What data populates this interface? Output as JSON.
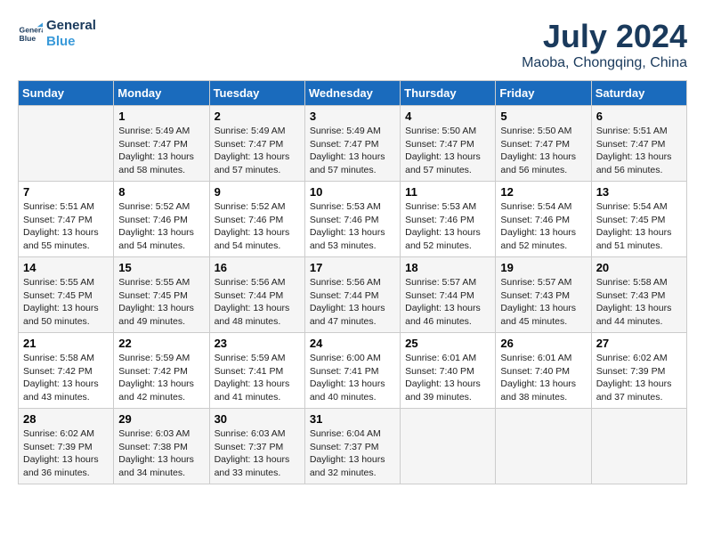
{
  "header": {
    "logo_line1": "General",
    "logo_line2": "Blue",
    "month": "July 2024",
    "location": "Maoba, Chongqing, China"
  },
  "days_of_week": [
    "Sunday",
    "Monday",
    "Tuesday",
    "Wednesday",
    "Thursday",
    "Friday",
    "Saturday"
  ],
  "weeks": [
    [
      {
        "day": "",
        "sunrise": "",
        "sunset": "",
        "daylight": ""
      },
      {
        "day": "1",
        "sunrise": "Sunrise: 5:49 AM",
        "sunset": "Sunset: 7:47 PM",
        "daylight": "Daylight: 13 hours and 58 minutes."
      },
      {
        "day": "2",
        "sunrise": "Sunrise: 5:49 AM",
        "sunset": "Sunset: 7:47 PM",
        "daylight": "Daylight: 13 hours and 57 minutes."
      },
      {
        "day": "3",
        "sunrise": "Sunrise: 5:49 AM",
        "sunset": "Sunset: 7:47 PM",
        "daylight": "Daylight: 13 hours and 57 minutes."
      },
      {
        "day": "4",
        "sunrise": "Sunrise: 5:50 AM",
        "sunset": "Sunset: 7:47 PM",
        "daylight": "Daylight: 13 hours and 57 minutes."
      },
      {
        "day": "5",
        "sunrise": "Sunrise: 5:50 AM",
        "sunset": "Sunset: 7:47 PM",
        "daylight": "Daylight: 13 hours and 56 minutes."
      },
      {
        "day": "6",
        "sunrise": "Sunrise: 5:51 AM",
        "sunset": "Sunset: 7:47 PM",
        "daylight": "Daylight: 13 hours and 56 minutes."
      }
    ],
    [
      {
        "day": "7",
        "sunrise": "Sunrise: 5:51 AM",
        "sunset": "Sunset: 7:47 PM",
        "daylight": "Daylight: 13 hours and 55 minutes."
      },
      {
        "day": "8",
        "sunrise": "Sunrise: 5:52 AM",
        "sunset": "Sunset: 7:46 PM",
        "daylight": "Daylight: 13 hours and 54 minutes."
      },
      {
        "day": "9",
        "sunrise": "Sunrise: 5:52 AM",
        "sunset": "Sunset: 7:46 PM",
        "daylight": "Daylight: 13 hours and 54 minutes."
      },
      {
        "day": "10",
        "sunrise": "Sunrise: 5:53 AM",
        "sunset": "Sunset: 7:46 PM",
        "daylight": "Daylight: 13 hours and 53 minutes."
      },
      {
        "day": "11",
        "sunrise": "Sunrise: 5:53 AM",
        "sunset": "Sunset: 7:46 PM",
        "daylight": "Daylight: 13 hours and 52 minutes."
      },
      {
        "day": "12",
        "sunrise": "Sunrise: 5:54 AM",
        "sunset": "Sunset: 7:46 PM",
        "daylight": "Daylight: 13 hours and 52 minutes."
      },
      {
        "day": "13",
        "sunrise": "Sunrise: 5:54 AM",
        "sunset": "Sunset: 7:45 PM",
        "daylight": "Daylight: 13 hours and 51 minutes."
      }
    ],
    [
      {
        "day": "14",
        "sunrise": "Sunrise: 5:55 AM",
        "sunset": "Sunset: 7:45 PM",
        "daylight": "Daylight: 13 hours and 50 minutes."
      },
      {
        "day": "15",
        "sunrise": "Sunrise: 5:55 AM",
        "sunset": "Sunset: 7:45 PM",
        "daylight": "Daylight: 13 hours and 49 minutes."
      },
      {
        "day": "16",
        "sunrise": "Sunrise: 5:56 AM",
        "sunset": "Sunset: 7:44 PM",
        "daylight": "Daylight: 13 hours and 48 minutes."
      },
      {
        "day": "17",
        "sunrise": "Sunrise: 5:56 AM",
        "sunset": "Sunset: 7:44 PM",
        "daylight": "Daylight: 13 hours and 47 minutes."
      },
      {
        "day": "18",
        "sunrise": "Sunrise: 5:57 AM",
        "sunset": "Sunset: 7:44 PM",
        "daylight": "Daylight: 13 hours and 46 minutes."
      },
      {
        "day": "19",
        "sunrise": "Sunrise: 5:57 AM",
        "sunset": "Sunset: 7:43 PM",
        "daylight": "Daylight: 13 hours and 45 minutes."
      },
      {
        "day": "20",
        "sunrise": "Sunrise: 5:58 AM",
        "sunset": "Sunset: 7:43 PM",
        "daylight": "Daylight: 13 hours and 44 minutes."
      }
    ],
    [
      {
        "day": "21",
        "sunrise": "Sunrise: 5:58 AM",
        "sunset": "Sunset: 7:42 PM",
        "daylight": "Daylight: 13 hours and 43 minutes."
      },
      {
        "day": "22",
        "sunrise": "Sunrise: 5:59 AM",
        "sunset": "Sunset: 7:42 PM",
        "daylight": "Daylight: 13 hours and 42 minutes."
      },
      {
        "day": "23",
        "sunrise": "Sunrise: 5:59 AM",
        "sunset": "Sunset: 7:41 PM",
        "daylight": "Daylight: 13 hours and 41 minutes."
      },
      {
        "day": "24",
        "sunrise": "Sunrise: 6:00 AM",
        "sunset": "Sunset: 7:41 PM",
        "daylight": "Daylight: 13 hours and 40 minutes."
      },
      {
        "day": "25",
        "sunrise": "Sunrise: 6:01 AM",
        "sunset": "Sunset: 7:40 PM",
        "daylight": "Daylight: 13 hours and 39 minutes."
      },
      {
        "day": "26",
        "sunrise": "Sunrise: 6:01 AM",
        "sunset": "Sunset: 7:40 PM",
        "daylight": "Daylight: 13 hours and 38 minutes."
      },
      {
        "day": "27",
        "sunrise": "Sunrise: 6:02 AM",
        "sunset": "Sunset: 7:39 PM",
        "daylight": "Daylight: 13 hours and 37 minutes."
      }
    ],
    [
      {
        "day": "28",
        "sunrise": "Sunrise: 6:02 AM",
        "sunset": "Sunset: 7:39 PM",
        "daylight": "Daylight: 13 hours and 36 minutes."
      },
      {
        "day": "29",
        "sunrise": "Sunrise: 6:03 AM",
        "sunset": "Sunset: 7:38 PM",
        "daylight": "Daylight: 13 hours and 34 minutes."
      },
      {
        "day": "30",
        "sunrise": "Sunrise: 6:03 AM",
        "sunset": "Sunset: 7:37 PM",
        "daylight": "Daylight: 13 hours and 33 minutes."
      },
      {
        "day": "31",
        "sunrise": "Sunrise: 6:04 AM",
        "sunset": "Sunset: 7:37 PM",
        "daylight": "Daylight: 13 hours and 32 minutes."
      },
      {
        "day": "",
        "sunrise": "",
        "sunset": "",
        "daylight": ""
      },
      {
        "day": "",
        "sunrise": "",
        "sunset": "",
        "daylight": ""
      },
      {
        "day": "",
        "sunrise": "",
        "sunset": "",
        "daylight": ""
      }
    ]
  ]
}
